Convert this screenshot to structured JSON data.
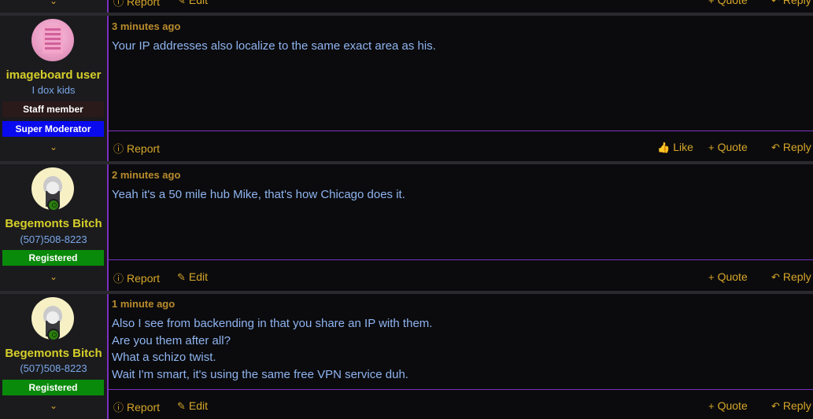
{
  "top_actions": {
    "report": "Report",
    "edit": "Edit",
    "quote": "Quote",
    "reply": "Reply"
  },
  "posts": [
    {
      "username": "imageboard user",
      "user_title": "I dox kids",
      "banners": [
        "Staff member",
        "Super Moderator"
      ],
      "time": "3 minutes ago",
      "lines": [
        "Your IP addresses also localize to the same exact area as his."
      ],
      "actions": {
        "report": "Report",
        "like": "Like",
        "quote": "Quote",
        "reply": "Reply"
      }
    },
    {
      "username": "Begemonts Bitch",
      "user_title": "(507)508-8223",
      "banners": [
        "Registered"
      ],
      "time": "2 minutes ago",
      "lines": [
        "Yeah it's a 50 mile hub Mike, that's how Chicago does it."
      ],
      "actions": {
        "report": "Report",
        "edit": "Edit",
        "quote": "Quote",
        "reply": "Reply"
      }
    },
    {
      "username": "Begemonts Bitch",
      "user_title": "(507)508-8223",
      "banners": [
        "Registered"
      ],
      "time": "1 minute ago",
      "lines": [
        "Also I see from backending in that you share an IP with them.",
        "Are you them after all?",
        "What a schizo twist.",
        "Wait I'm smart, it's using the same free VPN service duh."
      ],
      "actions": {
        "report": "Report",
        "edit": "Edit",
        "quote": "Quote",
        "reply": "Reply"
      }
    }
  ],
  "colors": {
    "accent": "#7b2fbf",
    "username": "#d6cf2a",
    "link": "#d6a62a",
    "text": "#8fb4f0",
    "staff": "#2b1a1a",
    "mod": "#0a0aee",
    "registered": "#0a8a0a"
  }
}
